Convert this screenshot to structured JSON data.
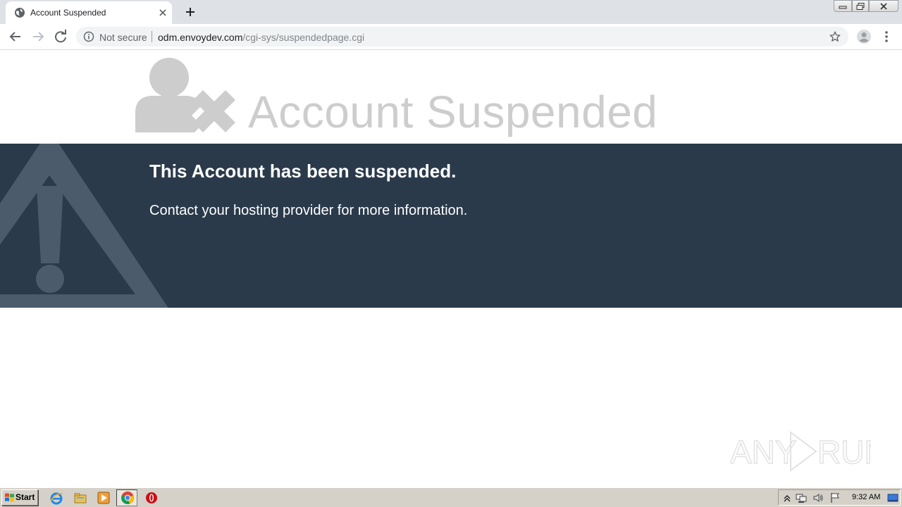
{
  "browser": {
    "tab": {
      "title": "Account Suspended"
    },
    "omnibox": {
      "security_label": "Not secure",
      "url_host": "odm.envoydev.com",
      "url_path": "/cgi-sys/suspendedpage.cgi"
    },
    "icons": [
      "globe-icon",
      "close-icon",
      "plus-icon",
      "back-icon",
      "forward-icon",
      "reload-icon",
      "info-icon",
      "star-icon",
      "profile-icon",
      "menu-icon"
    ]
  },
  "page": {
    "hero_title": "Account Suspended",
    "banner": {
      "heading": "This Account has been suspended.",
      "text": "Contact your hosting provider for more information."
    },
    "watermark": "ANY RUN",
    "colors": {
      "banner_bg": "#2a3a4b",
      "hero_gray": "#cdcdcd",
      "warning_gray": "#4b5b6b"
    }
  },
  "taskbar": {
    "start_label": "Start",
    "clock": "9:32 AM",
    "apps": [
      "ie-icon",
      "explorer-icon",
      "media-player-icon",
      "chrome-icon",
      "opera-icon"
    ]
  }
}
